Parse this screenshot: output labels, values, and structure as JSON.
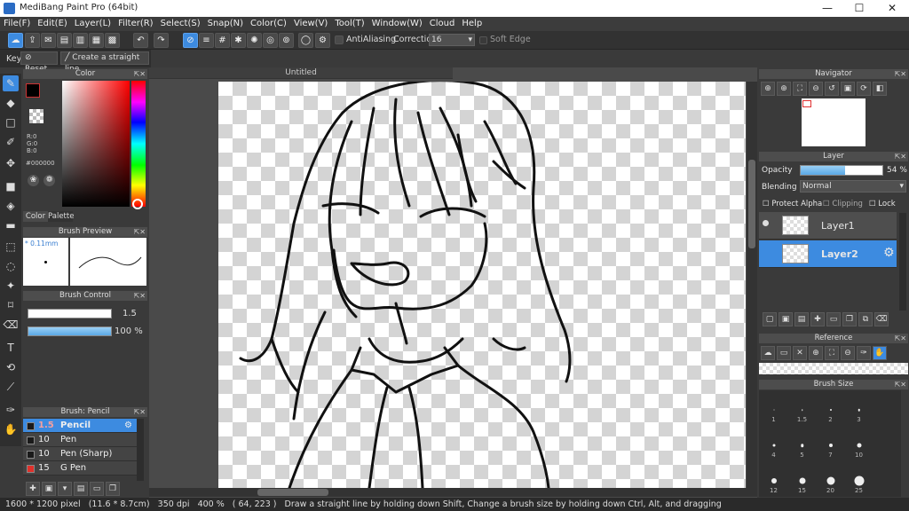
{
  "window": {
    "title": "MediBang Paint Pro (64bit)",
    "minimize": "—",
    "maximize": "☐",
    "close": "✕"
  },
  "menu": [
    "File(F)",
    "Edit(E)",
    "Layer(L)",
    "Filter(R)",
    "Select(S)",
    "Snap(N)",
    "Color(C)",
    "View(V)",
    "Tool(T)",
    "Window(W)",
    "Cloud",
    "Help"
  ],
  "toolbar": {
    "antialiasing_label": "AntiAliasing",
    "correction_label": "Correction",
    "correction_value": "16",
    "soft_edge_label": "Soft Edge"
  },
  "toolbar2": {
    "key_label": "Key",
    "reset_label": "Reset",
    "straight_line_label": "Create a straight line"
  },
  "color_panel": {
    "title": "Color",
    "foreground": "#000000",
    "r": "R:0",
    "g": "G:0",
    "b": "B:0",
    "hex": "#000000",
    "tabs": [
      "Color",
      "Palette"
    ]
  },
  "brush_preview": {
    "title": "Brush Preview",
    "size": "* 0.11mm"
  },
  "brush_control": {
    "title": "Brush Control",
    "size_value": "1.5",
    "opacity_value": "100 %",
    "opacity_fraction": 1.0
  },
  "brush_list": {
    "title": "Brush: Pencil",
    "items": [
      {
        "size": "1.5",
        "name": "Pencil",
        "color": "#1a1a1a",
        "selected": true
      },
      {
        "size": "10",
        "name": "Pen",
        "color": "#1a1a1a",
        "selected": false
      },
      {
        "size": "10",
        "name": "Pen (Sharp)",
        "color": "#1a1a1a",
        "selected": false
      },
      {
        "size": "15",
        "name": "G Pen",
        "color": "#e0302a",
        "selected": false
      }
    ]
  },
  "document": {
    "tab_title": "Untitled"
  },
  "navigator": {
    "title": "Navigator"
  },
  "layer_panel": {
    "title": "Layer",
    "opacity_label": "Opacity",
    "opacity_value": "54 %",
    "opacity_fraction": 0.54,
    "blending_label": "Blending",
    "blending_value": "Normal",
    "protect_alpha": "Protect Alpha",
    "clipping": "Clipping",
    "lock": "Lock",
    "layers": [
      {
        "name": "Layer1",
        "selected": false
      },
      {
        "name": "Layer2",
        "selected": true
      }
    ]
  },
  "reference": {
    "title": "Reference"
  },
  "brush_size": {
    "title": "Brush Size",
    "sizes": [
      "1",
      "1.5",
      "2",
      "3",
      "4",
      "5",
      "7",
      "10",
      "12",
      "15",
      "20",
      "25"
    ]
  },
  "status": {
    "pixels": "1600 * 1200 pixel",
    "physical": "(11.6 * 8.7cm)",
    "dpi": "350 dpi",
    "zoom": "400 %",
    "coords": "( 64, 223 )",
    "hint": "Draw a straight line by holding down Shift, Change a brush size by holding down Ctrl, Alt, and dragging"
  }
}
